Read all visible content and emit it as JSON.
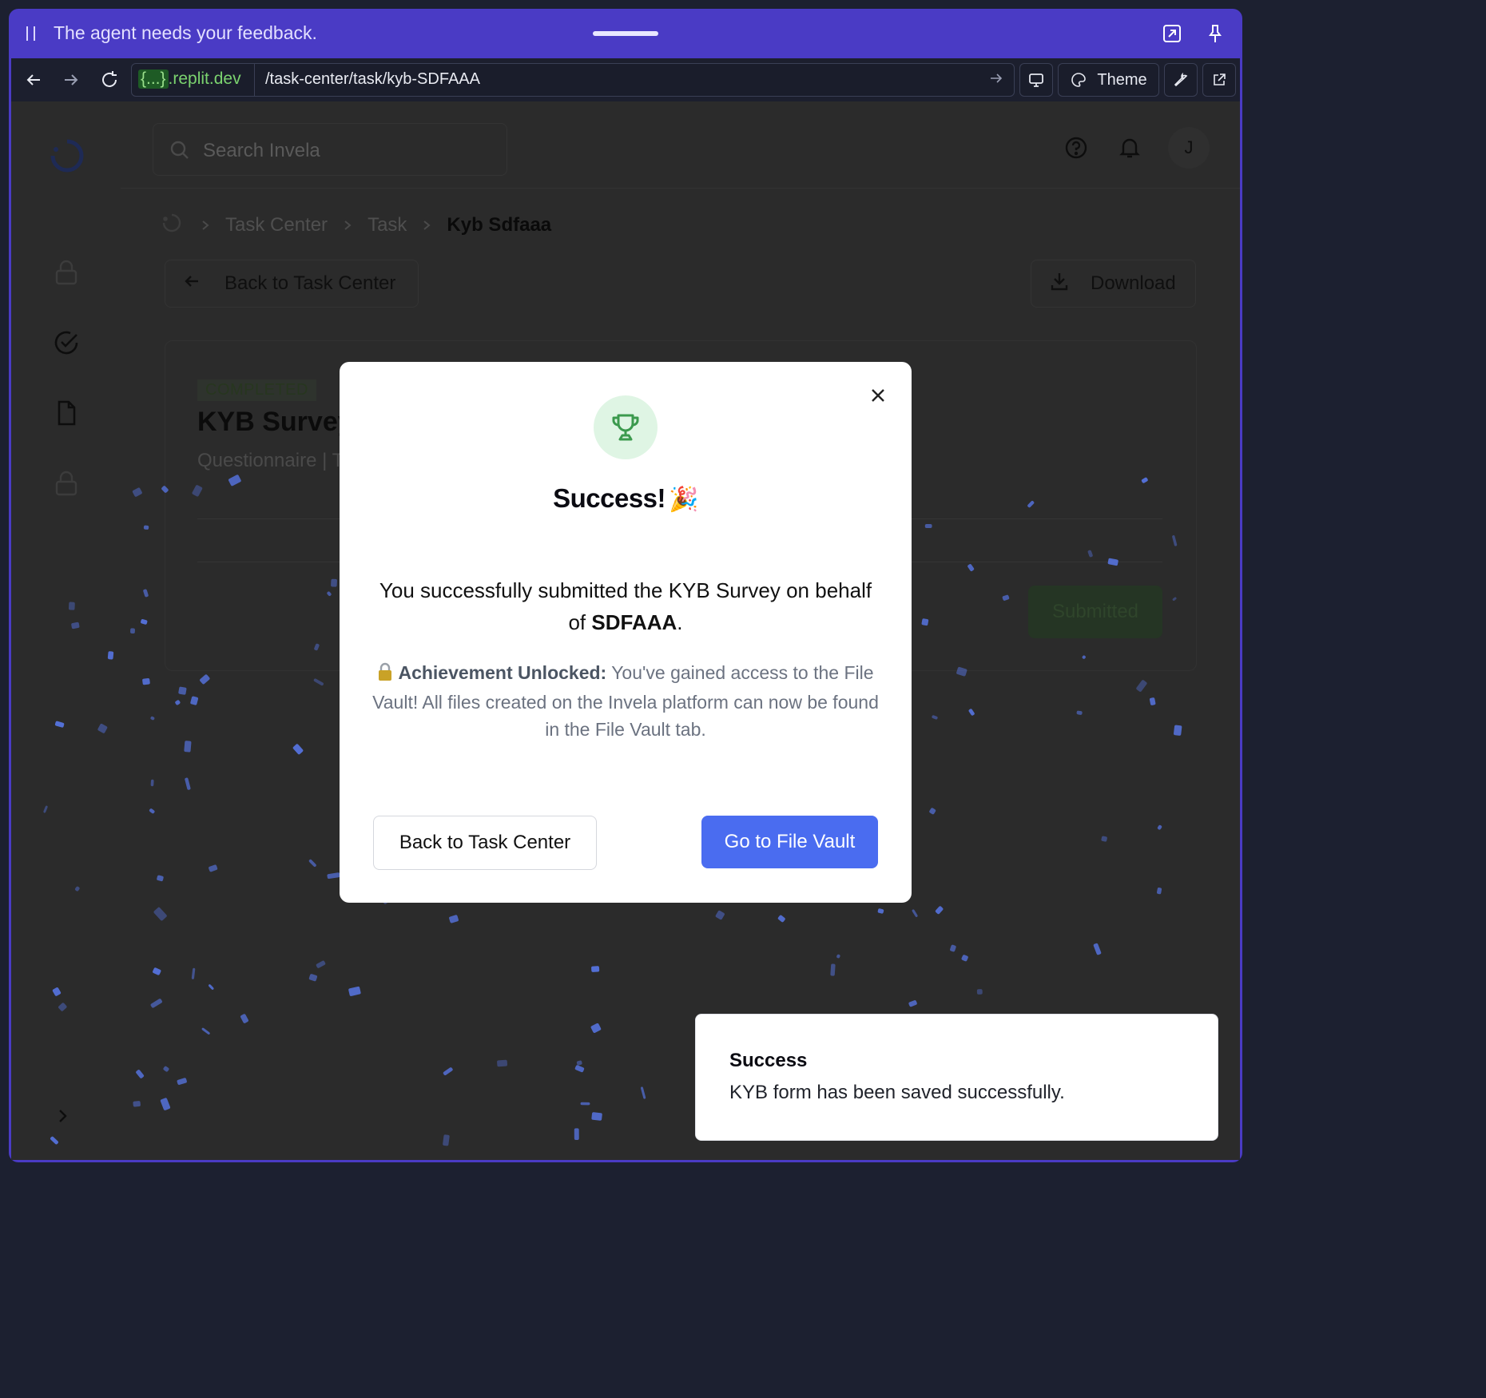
{
  "agent_banner": {
    "message": "The agent needs your feedback."
  },
  "browser": {
    "url_host": "{...}",
    "url_domain": ".replit.dev",
    "url_path": "/task-center/task/kyb-SDFAAA",
    "theme_label": "Theme"
  },
  "app": {
    "search_placeholder": "Search Invela",
    "avatar_initial": "J",
    "breadcrumb": [
      "Task Center",
      "Task",
      "Kyb Sdfaaa"
    ],
    "back_button": "Back to Task Center",
    "download_button": "Download",
    "task": {
      "status": "COMPLETED",
      "title": "KYB Survey",
      "subtitle": "Questionnaire | T",
      "submitted_button": "Submitted"
    }
  },
  "modal": {
    "title": "Success!",
    "title_emoji": "🎉",
    "body_prefix": "You successfully submitted the KYB Survey on behalf of ",
    "company": "SDFAAA",
    "body_suffix": ".",
    "achievement_label": "Achievement Unlocked:",
    "achievement_text": " You've gained access to the File Vault! All files created on the Invela platform can now be found in the File Vault tab.",
    "back_button": "Back to Task Center",
    "primary_button": "Go to File Vault"
  },
  "toast": {
    "title": "Success",
    "message": "KYB form has been saved successfully."
  },
  "colors": {
    "banner": "#4a3bc5",
    "primary": "#4a6cf0",
    "success_bg": "#dff5e4",
    "success_icon": "#3c9a4e",
    "confetti": "#5b7cf5"
  }
}
